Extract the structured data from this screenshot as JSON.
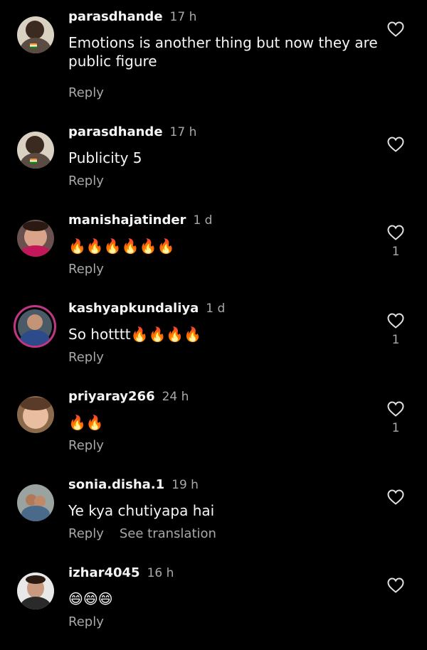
{
  "comments": [
    {
      "username": "parasdhande",
      "time": "17 h",
      "text": "Emotions is another thing but now they are public figure",
      "reply": "Reply"
    },
    {
      "username": "parasdhande",
      "time": "17 h",
      "text": "Publicity 5",
      "reply": "Reply"
    },
    {
      "username": "manishajatinder",
      "time": "1 d",
      "text": "🔥🔥🔥🔥🔥🔥",
      "reply": "Reply",
      "likes": "1"
    },
    {
      "username": "kashyapkundaliya",
      "time": "1 d",
      "text": "So hotttt🔥🔥🔥🔥",
      "reply": "Reply",
      "likes": "1"
    },
    {
      "username": "priyaray266",
      "time": "24 h",
      "text": "🔥🔥",
      "reply": "Reply",
      "likes": "1"
    },
    {
      "username": "sonia.disha.1",
      "time": "19 h",
      "text": "Ye kya chutiyapa hai",
      "reply": "Reply",
      "see_translation": "See translation"
    },
    {
      "username": "izhar4045",
      "time": "16 h",
      "text": "😄😄😄",
      "reply": "Reply"
    }
  ],
  "colors": {
    "background": "#000000",
    "primary_text": "#f5f5f5",
    "secondary_text": "#a8a8a8",
    "story_ring": "#c13584"
  },
  "icons": {
    "like": "heart-outline-icon",
    "fire": "fire-emoji",
    "grin": "grinning-emoji"
  }
}
